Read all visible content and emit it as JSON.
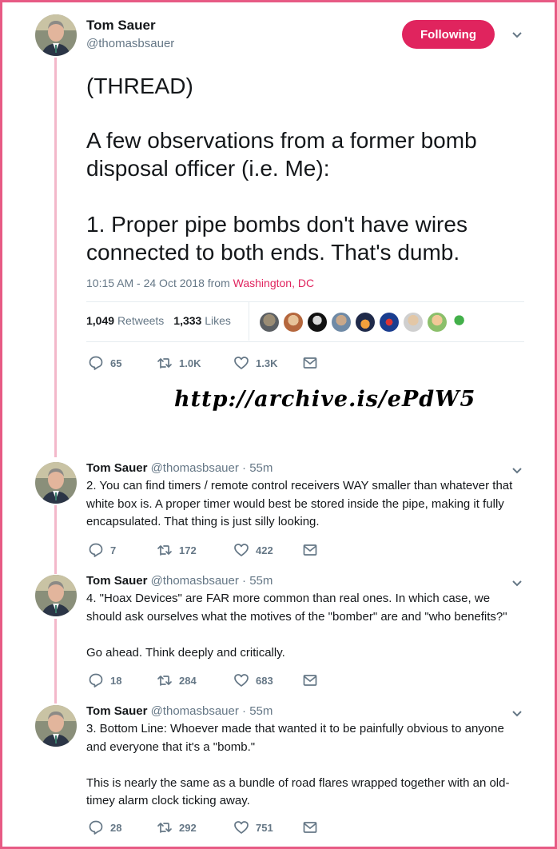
{
  "main": {
    "name": "Tom Sauer",
    "handle": "@thomasbsauer",
    "follow_label": "Following",
    "lines": [
      "(THREAD)",
      "A few observations from a former bomb",
      "disposal officer (i.e. Me):",
      "1. Proper pipe bombs don't have wires",
      "connected to both ends.  That's dumb."
    ],
    "time": "10:15 AM - 24 Oct 2018 from",
    "place": "Washington, DC",
    "retweets_count": "1,049",
    "retweets_label": "Retweets",
    "likes_count": "1,333",
    "likes_label": "Likes",
    "actions": {
      "reply": "65",
      "retweet": "1.0K",
      "like": "1.3K"
    }
  },
  "archive_link": "http://archive.is/ePdW5",
  "replies": [
    {
      "name": "Tom Sauer",
      "handle": "@thomasbsauer",
      "time": "· 55m",
      "lines": [
        "2. You can find timers / remote control receivers WAY smaller than whatever that",
        "white box is.  A proper timer would best be stored inside the pipe, making it fully",
        "encapsulated.  That thing is just silly looking."
      ],
      "actions": {
        "reply": "7",
        "retweet": "172",
        "like": "422"
      }
    },
    {
      "name": "Tom Sauer",
      "handle": "@thomasbsauer",
      "time": "· 55m",
      "lines": [
        "4. \"Hoax Devices\" are FAR more common than real ones.  In which case, we",
        "should ask ourselves what the motives of the \"bomber\" are and \"who benefits?\"",
        "",
        "Go ahead.  Think deeply and critically."
      ],
      "actions": {
        "reply": "18",
        "retweet": "284",
        "like": "683"
      }
    },
    {
      "name": "Tom Sauer",
      "handle": "@thomasbsauer",
      "time": "· 55m",
      "lines": [
        "3. Bottom Line: Whoever made that wanted it to be painfully obvious to anyone",
        "and everyone that it's a \"bomb.\"",
        "",
        "This is nearly the same as a bundle of road flares wrapped together with an old-",
        "timey alarm clock ticking away."
      ],
      "actions": {
        "reply": "28",
        "retweet": "292",
        "like": "751"
      }
    }
  ],
  "colors": {
    "accent": "#e0245e",
    "frame": "#e75a84",
    "muted": "#657786"
  }
}
